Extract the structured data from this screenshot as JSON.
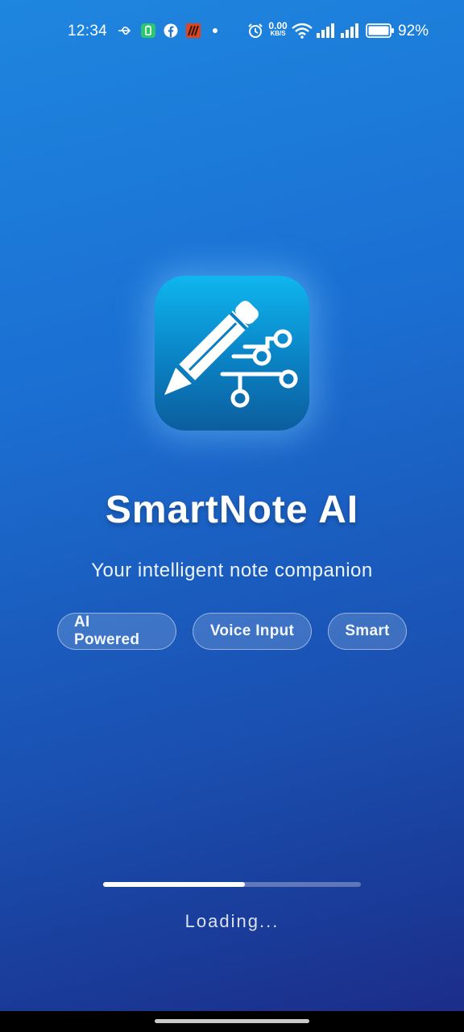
{
  "status_bar": {
    "time": "12:34",
    "net_speed_value": "0.00",
    "net_speed_unit": "KB/S",
    "battery_percent": "92%",
    "icons": [
      "usb-icon",
      "battery-saver-icon",
      "facebook-icon",
      "app-notification-icon",
      "dot-icon",
      "alarm-icon",
      "wifi-icon",
      "signal-icon",
      "signal-icon",
      "battery-icon"
    ]
  },
  "app": {
    "name": "SmartNote AI",
    "tagline": "Your intelligent note companion",
    "icon": "pencil-circuit-icon"
  },
  "features": [
    {
      "label": "AI Powered"
    },
    {
      "label": "Voice Input"
    },
    {
      "label": "Smart"
    }
  ],
  "loading": {
    "text": "Loading...",
    "progress": 0.55
  },
  "colors": {
    "background_top": "#1e86df",
    "background_bottom": "#1b2b86",
    "icon_top": "#0fb6ef",
    "icon_bottom": "#0c5d9d"
  }
}
